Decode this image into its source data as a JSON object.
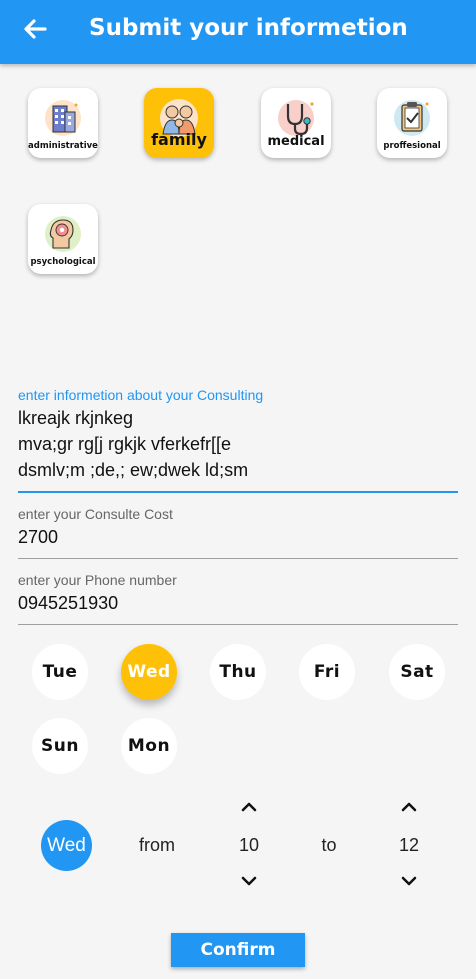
{
  "appbar": {
    "title": "Submit your informetion"
  },
  "categories": [
    {
      "label": "administrative",
      "icon": "building-icon"
    },
    {
      "label": "family",
      "icon": "family-icon",
      "selected": true
    },
    {
      "label": "medical",
      "icon": "stethoscope-icon"
    },
    {
      "label": "proffesional",
      "icon": "clipboard-icon"
    },
    {
      "label": "psychological",
      "icon": "brain-head-icon"
    }
  ],
  "form": {
    "consulting": {
      "label": "enter informetion about your Consulting",
      "lines": [
        "lkreajk rkjnkeg",
        "mva;gr rg[j rgkjk vferkefr[[e",
        "dsmlv;m ;de,; ew;dwek ld;sm"
      ]
    },
    "cost": {
      "label": "enter your Consulte Cost",
      "value": "2700"
    },
    "phone": {
      "label": "enter your Phone number",
      "value": "0945251930"
    }
  },
  "days": [
    "Tue",
    "Wed",
    "Thu",
    "Fri",
    "Sat",
    "Sun",
    "Mon"
  ],
  "selected_day": "Wed",
  "schedule": {
    "day": "Wed",
    "from_label": "from",
    "from_value": "10",
    "to_label": "to",
    "to_value": "12"
  },
  "confirm_label": "Confirm",
  "colors": {
    "primary": "#2196f3",
    "accent": "#ffc107"
  }
}
